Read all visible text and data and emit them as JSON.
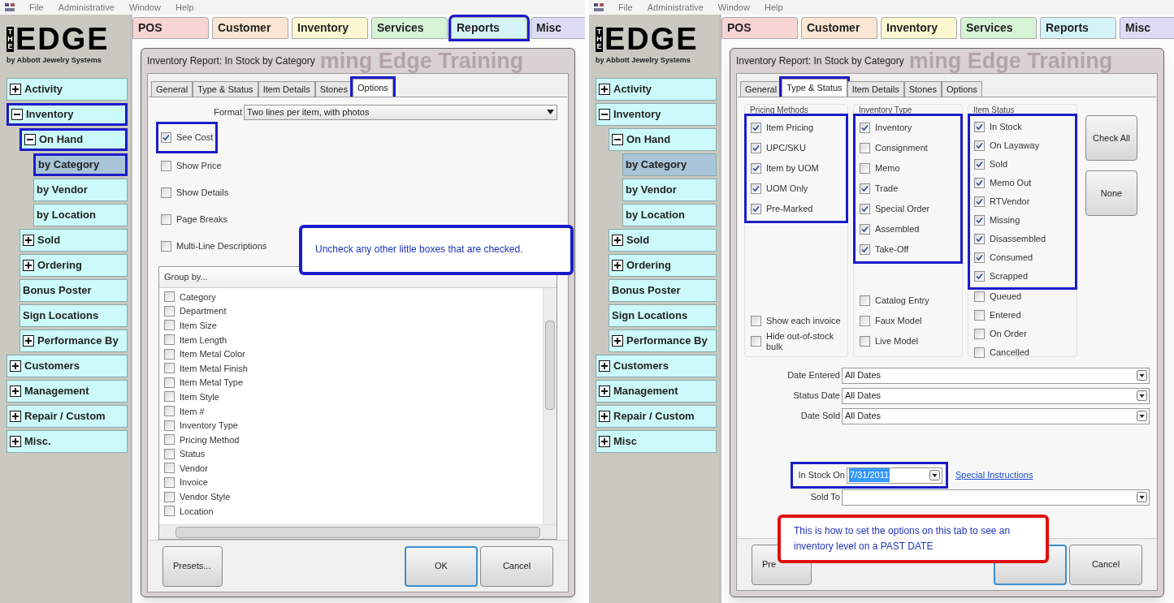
{
  "panels": [
    {
      "menu": [
        "File",
        "Administrative",
        "Window",
        "Help"
      ],
      "logo": {
        "side": "THE",
        "word": "EDGE",
        "subtitle": "by Abbott Jewelry Systems"
      },
      "module_tabs": [
        {
          "label": "POS",
          "color": "#f9d4d4",
          "highlighted": false
        },
        {
          "label": "Customer",
          "color": "#fae6d2",
          "highlighted": false
        },
        {
          "label": "Inventory",
          "color": "#fbf8d2",
          "highlighted": false
        },
        {
          "label": "Services",
          "color": "#d6f3d6",
          "highlighted": false
        },
        {
          "label": "Reports",
          "color": "#d4f3f7",
          "highlighted": true
        },
        {
          "label": "Misc",
          "color": "#dcdcf5",
          "highlighted": false
        }
      ],
      "sidebar": [
        {
          "label": "Activity",
          "expanded": false,
          "highlighted": false,
          "selected": false
        },
        {
          "label": "Inventory",
          "expanded": true,
          "highlighted": true,
          "selected": false,
          "children": [
            {
              "label": "On Hand",
              "expanded": true,
              "highlighted": true,
              "selected": false,
              "children": [
                {
                  "label": "by Category",
                  "highlighted": true,
                  "selected": true
                },
                {
                  "label": "by Vendor",
                  "highlighted": false,
                  "selected": false
                },
                {
                  "label": "by Location",
                  "highlighted": false,
                  "selected": false
                }
              ]
            },
            {
              "label": "Sold",
              "expanded": false,
              "highlighted": false,
              "selected": false
            },
            {
              "label": "Ordering",
              "expanded": false,
              "highlighted": false,
              "selected": false
            },
            {
              "label": "Bonus Poster",
              "highlighted": false,
              "selected": false
            },
            {
              "label": "Sign Locations",
              "highlighted": false,
              "selected": false
            },
            {
              "label": "Performance By",
              "expanded": false,
              "highlighted": false,
              "selected": false
            }
          ]
        },
        {
          "label": "Customers",
          "expanded": false,
          "highlighted": false,
          "selected": false
        },
        {
          "label": "Management",
          "expanded": false,
          "highlighted": false,
          "selected": false
        },
        {
          "label": "Repair / Custom",
          "expanded": false,
          "highlighted": false,
          "selected": false
        },
        {
          "label": "Misc.",
          "expanded": false,
          "highlighted": false,
          "selected": false
        }
      ],
      "dialog": {
        "title": "Inventory Report: In Stock by Category",
        "behind_title": "ming Edge Training",
        "tabs": [
          {
            "label": "General",
            "selected": false,
            "highlighted": false
          },
          {
            "label": "Type & Status",
            "selected": false,
            "highlighted": false
          },
          {
            "label": "Item Details",
            "selected": false,
            "highlighted": false
          },
          {
            "label": "Stones",
            "selected": false,
            "highlighted": false
          },
          {
            "label": "Options",
            "selected": true,
            "highlighted": true
          }
        ],
        "content": {
          "kind": "options",
          "format": {
            "label": "Format",
            "value": "Two lines per item, with photos"
          },
          "checkboxes": [
            {
              "label": "See Cost",
              "checked": true,
              "highlighted": true
            },
            {
              "label": "Show Price",
              "checked": false,
              "highlighted": false
            },
            {
              "label": "Show Details",
              "checked": false,
              "highlighted": false
            },
            {
              "label": "Page Breaks",
              "checked": false,
              "highlighted": false
            },
            {
              "label": "Multi-Line Descriptions",
              "checked": false,
              "highlighted": false
            }
          ],
          "group_by": {
            "header": "Group by...",
            "items": [
              {
                "label": "Category",
                "checked": false
              },
              {
                "label": "Department",
                "checked": false
              },
              {
                "label": "Item Size",
                "checked": false
              },
              {
                "label": "Item Length",
                "checked": false
              },
              {
                "label": "Item Metal Color",
                "checked": false
              },
              {
                "label": "Item Metal Finish",
                "checked": false
              },
              {
                "label": "Item Metal Type",
                "checked": false
              },
              {
                "label": "Item Style",
                "checked": false
              },
              {
                "label": "Item #",
                "checked": false
              },
              {
                "label": "Inventory Type",
                "checked": false
              },
              {
                "label": "Pricing Method",
                "checked": false
              },
              {
                "label": "Status",
                "checked": false
              },
              {
                "label": "Vendor",
                "checked": false
              },
              {
                "label": "Invoice",
                "checked": false
              },
              {
                "label": "Vendor Style",
                "checked": false
              },
              {
                "label": "Location",
                "checked": false
              }
            ]
          }
        },
        "buttons": [
          {
            "label": "Presets...",
            "kind": "secondary"
          },
          {
            "label": "OK",
            "kind": "default"
          },
          {
            "label": "Cancel",
            "kind": "secondary"
          }
        ]
      },
      "callout": {
        "text": "Uncheck any other little boxes that are checked.",
        "color": "#1a1ac8"
      }
    },
    {
      "menu": [
        "File",
        "Administrative",
        "Window",
        "Help"
      ],
      "logo": {
        "side": "THE",
        "word": "EDGE",
        "subtitle": "by Abbott Jewelry Systems"
      },
      "module_tabs": [
        {
          "label": "POS",
          "color": "#f9d4d4",
          "highlighted": false
        },
        {
          "label": "Customer",
          "color": "#fae6d2",
          "highlighted": false
        },
        {
          "label": "Inventory",
          "color": "#fbf8d2",
          "highlighted": false
        },
        {
          "label": "Services",
          "color": "#d6f3d6",
          "highlighted": false
        },
        {
          "label": "Reports",
          "color": "#d4f3f7",
          "highlighted": false
        },
        {
          "label": "Misc",
          "color": "#dcdcf5",
          "highlighted": false
        }
      ],
      "sidebar": [
        {
          "label": "Activity",
          "expanded": false,
          "highlighted": false,
          "selected": false
        },
        {
          "label": "Inventory",
          "expanded": true,
          "highlighted": false,
          "selected": false,
          "children": [
            {
              "label": "On Hand",
              "expanded": true,
              "highlighted": false,
              "selected": false,
              "children": [
                {
                  "label": "by Category",
                  "highlighted": false,
                  "selected": true
                },
                {
                  "label": "by Vendor",
                  "highlighted": false,
                  "selected": false
                },
                {
                  "label": "by Location",
                  "highlighted": false,
                  "selected": false
                }
              ]
            },
            {
              "label": "Sold",
              "expanded": false,
              "highlighted": false,
              "selected": false
            },
            {
              "label": "Ordering",
              "expanded": false,
              "highlighted": false,
              "selected": false
            },
            {
              "label": "Bonus Poster",
              "highlighted": false,
              "selected": false
            },
            {
              "label": "Sign Locations",
              "highlighted": false,
              "selected": false
            },
            {
              "label": "Performance By",
              "expanded": false,
              "highlighted": false,
              "selected": false
            }
          ]
        },
        {
          "label": "Customers",
          "expanded": false,
          "highlighted": false,
          "selected": false
        },
        {
          "label": "Management",
          "expanded": false,
          "highlighted": false,
          "selected": false
        },
        {
          "label": "Repair / Custom",
          "expanded": false,
          "highlighted": false,
          "selected": false
        },
        {
          "label": "Misc",
          "expanded": false,
          "highlighted": false,
          "selected": false
        }
      ],
      "dialog": {
        "title": "Inventory Report: In Stock by Category",
        "behind_title": "ming Edge Training",
        "tabs": [
          {
            "label": "General",
            "selected": false,
            "highlighted": false
          },
          {
            "label": "Type & Status",
            "selected": true,
            "highlighted": true
          },
          {
            "label": "Item Details",
            "selected": false,
            "highlighted": false
          },
          {
            "label": "Stones",
            "selected": false,
            "highlighted": false
          },
          {
            "label": "Options",
            "selected": false,
            "highlighted": false
          }
        ],
        "content": {
          "kind": "type_status",
          "groups": [
            {
              "title": "Pricing Methods",
              "highlighted": true,
              "items": [
                {
                  "label": "Item Pricing",
                  "checked": true
                },
                {
                  "label": "UPC/SKU",
                  "checked": true
                },
                {
                  "label": "Item by UOM",
                  "checked": true
                },
                {
                  "label": "UOM Only",
                  "checked": true
                },
                {
                  "label": "Pre-Marked",
                  "checked": true
                }
              ],
              "extras": [
                {
                  "label": "Show each invoice",
                  "checked": false
                },
                {
                  "label": "Hide out-of-stock bulk",
                  "checked": false
                }
              ]
            },
            {
              "title": "Inventory Type",
              "highlighted": true,
              "items": [
                {
                  "label": "Inventory",
                  "checked": true
                },
                {
                  "label": "Consignment",
                  "checked": false
                },
                {
                  "label": "Memo",
                  "checked": false
                },
                {
                  "label": "Trade",
                  "checked": true
                },
                {
                  "label": "Special Order",
                  "checked": true
                },
                {
                  "label": "Assembled",
                  "checked": true
                },
                {
                  "label": "Take-Off",
                  "checked": true
                }
              ],
              "extras": [
                {
                  "label": "Catalog Entry",
                  "checked": false
                },
                {
                  "label": "Faux Model",
                  "checked": false
                },
                {
                  "label": "Live Model",
                  "checked": false
                }
              ]
            },
            {
              "title": "Item Status",
              "highlighted": true,
              "items": [
                {
                  "label": "In Stock",
                  "checked": true
                },
                {
                  "label": "On Layaway",
                  "checked": true
                },
                {
                  "label": "Sold",
                  "checked": true
                },
                {
                  "label": "Memo Out",
                  "checked": true
                },
                {
                  "label": "RTVendor",
                  "checked": true
                },
                {
                  "label": "Missing",
                  "checked": true
                },
                {
                  "label": "Disassembled",
                  "checked": true
                },
                {
                  "label": "Consumed",
                  "checked": true
                },
                {
                  "label": "Scrapped",
                  "checked": true
                }
              ],
              "extras": [
                {
                  "label": "Queued",
                  "checked": false
                },
                {
                  "label": "Entered",
                  "checked": false
                },
                {
                  "label": "On Order",
                  "checked": false
                },
                {
                  "label": "Cancelled",
                  "checked": false
                }
              ]
            }
          ],
          "side_buttons": [
            "Check All",
            "None"
          ],
          "date_fields": [
            {
              "label": "Date Entered",
              "value": "All Dates"
            },
            {
              "label": "Status Date",
              "value": "All Dates"
            },
            {
              "label": "Date Sold",
              "value": "All Dates"
            }
          ],
          "stock_on": {
            "label": "In Stock On",
            "value": "7/31/2011",
            "highlighted": true,
            "link": "Special Instructions"
          },
          "sold_to": {
            "label": "Sold To"
          }
        },
        "buttons": [
          {
            "label": "Pre",
            "kind": "secondary"
          },
          {
            "kind": "default"
          },
          {
            "label": "Cancel",
            "kind": "secondary"
          }
        ]
      },
      "callout": {
        "text": "This is how to set the options on this tab to see an inventory level on a PAST DATE",
        "color": "#e01010"
      }
    }
  ]
}
